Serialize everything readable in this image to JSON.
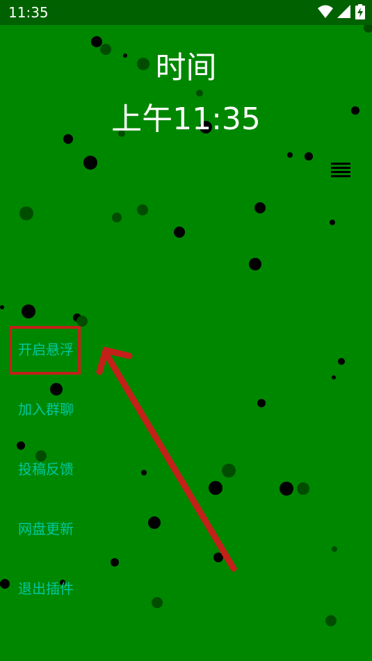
{
  "status_bar": {
    "time": "11:35",
    "icons": [
      "wifi-icon",
      "signal-icon",
      "battery-charging-icon"
    ]
  },
  "clock": {
    "title": "时间",
    "time": "上午11:35"
  },
  "menu_icon": "hamburger-menu-icon",
  "menu": {
    "items": [
      {
        "label": "开启悬浮"
      },
      {
        "label": "加入群聊"
      },
      {
        "label": "投稿反馈"
      },
      {
        "label": "网盘更新"
      },
      {
        "label": "退出插件"
      }
    ]
  },
  "colors": {
    "background": "#008700",
    "status_bar": "#006100",
    "menu_text": "#00c8a0",
    "annotation": "#c4201a"
  }
}
